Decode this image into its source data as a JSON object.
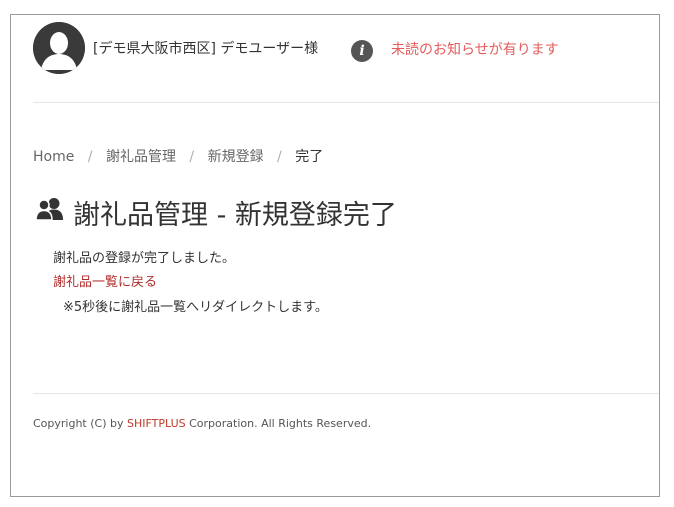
{
  "header": {
    "user_name": "[デモ県大阪市西区] デモユーザー様",
    "info_icon": "info-icon",
    "notice": "未読のお知らせが有ります",
    "notice_color": "#e25c5c"
  },
  "breadcrumb": {
    "home": "Home",
    "section": "謝礼品管理",
    "page": "新規登録",
    "current": "完了",
    "separator": "/"
  },
  "main": {
    "title": "謝礼品管理 - 新規登録完了",
    "title_icon": "users-icon",
    "message": "謝礼品の登録が完了しました。",
    "back_link": "謝礼品一覧に戻る",
    "back_link_color": "#b22b2b",
    "redirect_note": "※5秒後に謝礼品一覧へリダイレクトします。"
  },
  "footer": {
    "prefix": "Copyright (C) by ",
    "company": "SHIFTPLUS",
    "suffix": " Corporation. All Rights Reserved."
  }
}
